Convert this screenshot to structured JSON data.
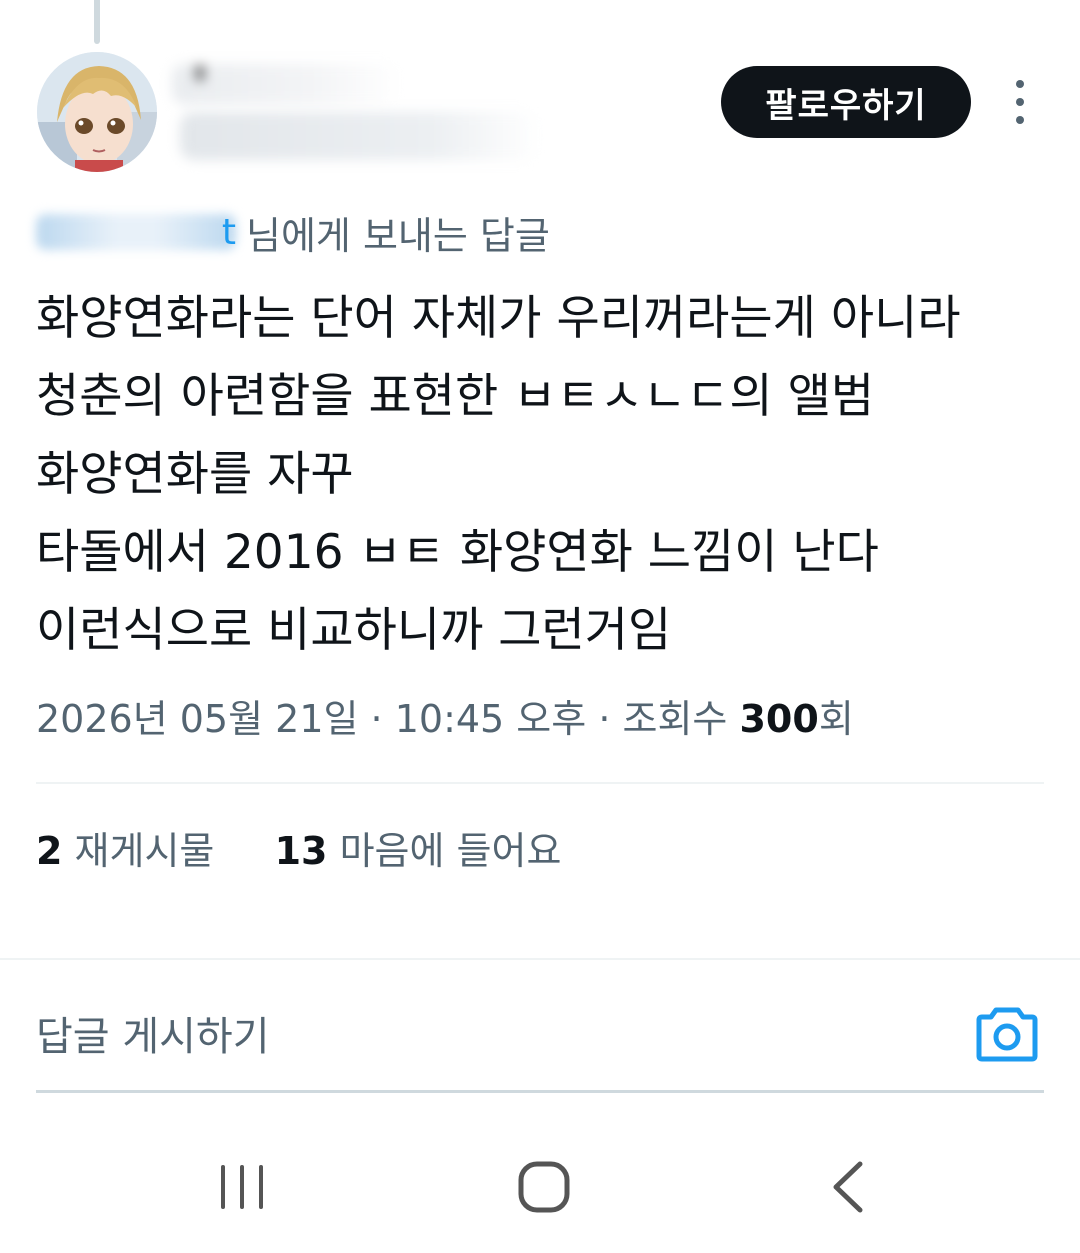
{
  "header": {
    "follow_label": "팔로우하기"
  },
  "reply_to": {
    "handle_fragment": "t",
    "suffix": "님에게 보내는 답글"
  },
  "tweet": {
    "lines": [
      "화양연화라는 단어 자체가 우리꺼라는게 아니라",
      "청춘의 아련함을 표현한 ㅂㅌㅅㄴㄷ의 앨범",
      "화양연화를 자꾸",
      "타돌에서 2016 ㅂㅌ 화양연화 느낌이 난다",
      "이런식으로 비교하니까 그런거임"
    ],
    "date": "2026년 05월 21일",
    "time": "10:45 오후",
    "views_label": "조회수",
    "views_count": "300",
    "views_suffix": "회"
  },
  "stats": {
    "retweets_count": "2",
    "retweets_label": "재게시물",
    "likes_count": "13",
    "likes_label": "마음에 들어요"
  },
  "composer": {
    "placeholder": "답글 게시하기"
  },
  "icons": {
    "more": "more-vertical-icon",
    "camera": "camera-icon",
    "nav_recent": "recent-apps-icon",
    "nav_home": "home-icon",
    "nav_back": "back-icon"
  },
  "colors": {
    "accent": "#1d9bf0",
    "text": "#0f1419",
    "secondary": "#536471"
  }
}
